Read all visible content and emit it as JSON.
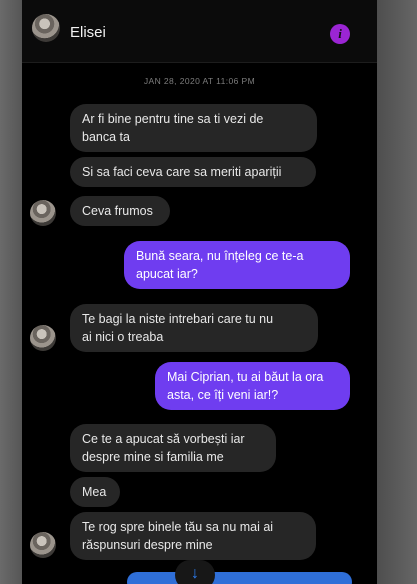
{
  "header": {
    "contact_name": "Elisei",
    "info_glyph": "i"
  },
  "thread": {
    "date_label": "JAN 28, 2020 AT 11:06 PM",
    "messages": [
      {
        "dir": "in",
        "line1": "Ar fi bine pentru tine sa ti vezi de",
        "line2": "banca ta"
      },
      {
        "dir": "in",
        "line1": "Si sa faci ceva care sa meriti apariții"
      },
      {
        "dir": "in",
        "line1": "Ceva frumos"
      },
      {
        "dir": "out",
        "line1": "Bună seara, nu înțeleg ce te-a",
        "line2": "apucat iar?"
      },
      {
        "dir": "in",
        "line1": "Te bagi la niste intrebari care tu nu",
        "line2": "ai nici o treaba"
      },
      {
        "dir": "out",
        "line1": "Mai Ciprian, tu ai băut la ora",
        "line2": "asta, ce îți veni iar!?"
      },
      {
        "dir": "in",
        "line1": "Ce te a apucat să vorbești  iar",
        "line2": "despre mine si familia me"
      },
      {
        "dir": "in",
        "line1": "Mea"
      },
      {
        "dir": "in",
        "line1": "Te rog spre binele tău sa nu mai ai",
        "line2": "răspunsuri despre mine"
      }
    ]
  },
  "scroll_button": {
    "glyph": "↓"
  },
  "colors": {
    "outgoing": "#6f3df0",
    "incoming": "#262626",
    "accent": "#9b25d4"
  }
}
